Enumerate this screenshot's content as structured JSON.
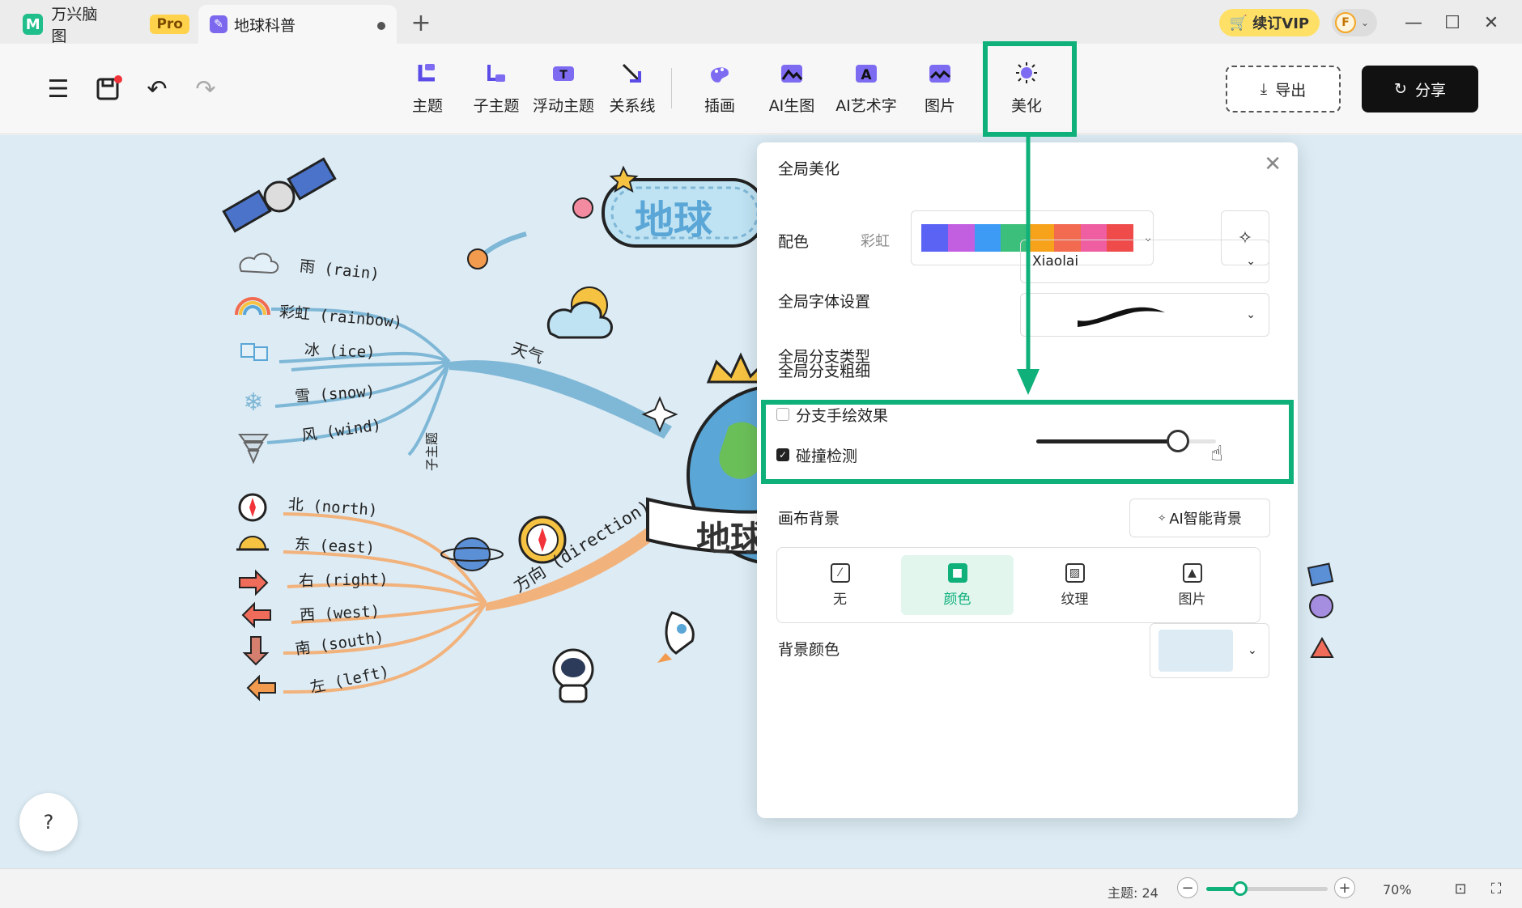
{
  "titlebar": {
    "app_name": "万兴脑图",
    "pro_badge": "Pro",
    "doc_tab": "地球科普",
    "new_tab": "+",
    "vip": "续订VIP",
    "avatar_letter": "F"
  },
  "toolbar": {
    "tools": [
      {
        "label": "主题",
        "icon": "topic-icon"
      },
      {
        "label": "子主题",
        "icon": "subtopic-icon"
      },
      {
        "label": "浮动主题",
        "icon": "floating-topic-icon"
      },
      {
        "label": "关系线",
        "icon": "relation-line-icon"
      },
      {
        "label": "插画",
        "icon": "illustration-icon"
      },
      {
        "label": "AI生图",
        "icon": "ai-image-icon"
      },
      {
        "label": "AI艺术字",
        "icon": "ai-art-text-icon"
      },
      {
        "label": "图片",
        "icon": "image-icon"
      },
      {
        "label": "美化",
        "icon": "beautify-icon"
      }
    ],
    "export": "导出",
    "share": "分享"
  },
  "mindmap": {
    "root": "地球",
    "root_banner": "地球",
    "branch_weather": "天气",
    "branch_direction": "方向 (direction)",
    "subtopic_vertical": "子主题",
    "weather_items": [
      "雨 (rain)",
      "彩虹 (rainbow)",
      "冰 (ice)",
      "雪 (snow)",
      "风 (wind)"
    ],
    "direction_items": [
      "北 (north)",
      "东 (east)",
      "右 (right)",
      "西 (west)",
      "南 (south)",
      "左 (left)"
    ]
  },
  "panel": {
    "title": "全局美化",
    "color_label": "配色",
    "color_scheme": "彩虹",
    "swatches": [
      "#5b63f5",
      "#c25ee0",
      "#3d9bf5",
      "#3cbf7a",
      "#f7a21b",
      "#f26a4f",
      "#ee5ea0",
      "#ef4b4b"
    ],
    "font_label": "全局字体设置",
    "font_value": "Xiaolai",
    "branch_type_label": "全局分支类型",
    "branch_width_label": "全局分支粗细",
    "branch_width_value": 0.79,
    "handdrawn_label": "分支手绘效果",
    "handdrawn_checked": false,
    "collision_label": "碰撞检测",
    "collision_checked": true,
    "canvas_bg_label": "画布背景",
    "ai_bg": "AI智能背景",
    "bg_options": [
      "无",
      "颜色",
      "纹理",
      "图片"
    ],
    "bg_selected": "颜色",
    "bg_color_label": "背景颜色",
    "bg_color": "#dcebf4"
  },
  "status": {
    "topic_count": "主题: 24",
    "zoom_minus": "−",
    "zoom_plus": "+",
    "zoom_level": "70%",
    "zoom_value": 0.28
  },
  "colors": {
    "accent": "#0fb07a",
    "weather_branch": "#7fb7d6",
    "direction_branch": "#f2b27c",
    "canvas": "#dcebf4"
  }
}
